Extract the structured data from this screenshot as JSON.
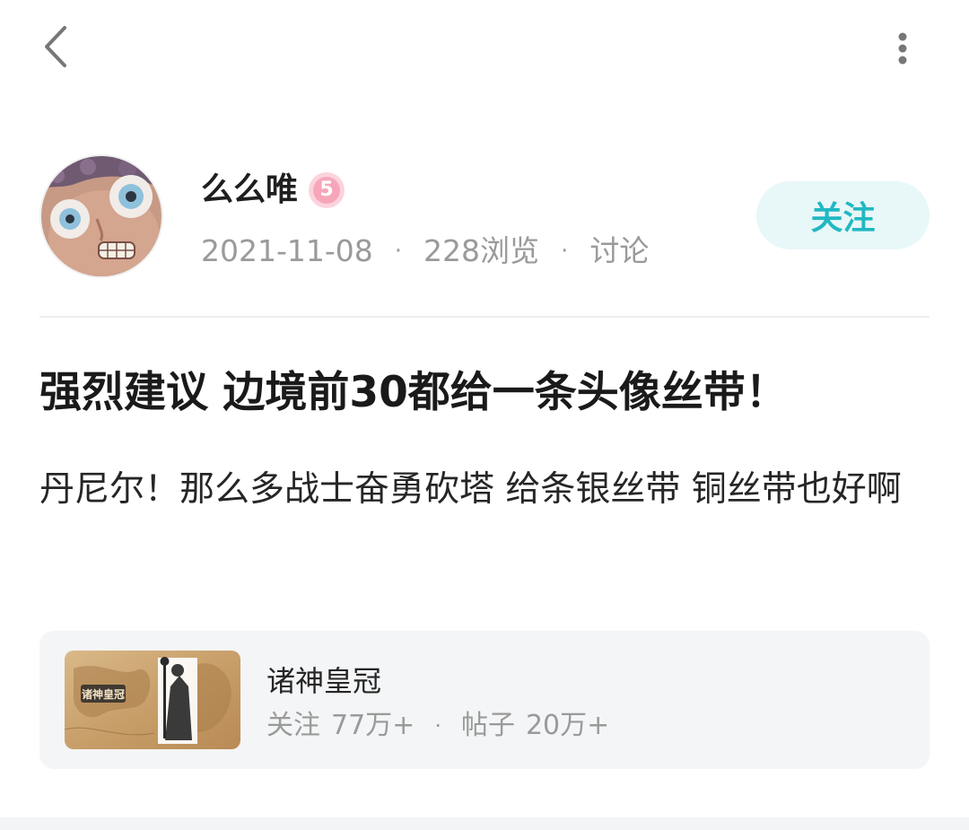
{
  "author": {
    "name": "么么唯",
    "level": "5",
    "date": "2021-11-08",
    "views": "228浏览",
    "category": "讨论",
    "meta_separator": "·"
  },
  "follow_label": "关注",
  "post": {
    "title": "强烈建议 边境前30都给一条头像丝带！",
    "body": "丹尼尔！那么多战士奋勇砍塔 给条银丝带 铜丝带也好啊"
  },
  "forum": {
    "name": "诸神皇冠",
    "followers_label": "关注",
    "followers": "77万+",
    "posts_label": "帖子",
    "posts": "20万+",
    "separator": "·",
    "logo_text": "诸神皇冠"
  },
  "icons": {
    "back": "chevron-left-icon",
    "more": "more-vertical-icon"
  },
  "colors": {
    "accent": "#21b8c2",
    "follow_bg": "#e8f7f8",
    "badge": "#f7a6ba",
    "meta_text": "#9a9a9a",
    "card_bg": "#f4f5f6"
  }
}
